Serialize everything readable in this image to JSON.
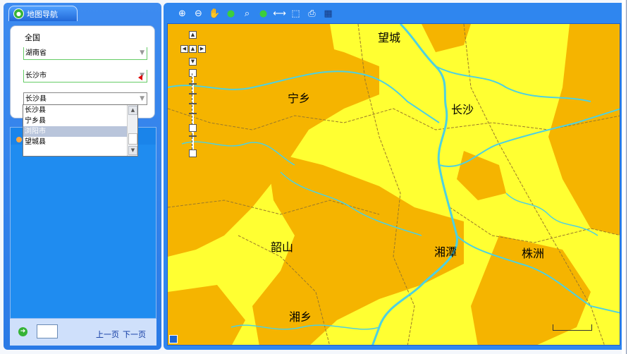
{
  "left_panel": {
    "tab_label": "地图导航",
    "region": {
      "label": "全国",
      "select1": "湖南省",
      "select2": "长沙市",
      "select3": "长沙县",
      "dropdown_options": [
        "长沙县",
        "宁乡县",
        "浏阳市",
        "望城县"
      ],
      "dropdown_selected": "浏阳市"
    },
    "pager": {
      "page_value": "",
      "prev": "上一页",
      "next": "下一页"
    }
  },
  "map": {
    "cities": [
      "望城",
      "宁乡",
      "长沙",
      "韶山",
      "湘潭",
      "株洲",
      "湘乡"
    ],
    "colors": {
      "land": "#ffff32",
      "upland": "#f5b400",
      "river": "#4ed1e0",
      "boundary": "#9a7a2a"
    }
  },
  "toolbar": {
    "tools": [
      "zoom-in-icon",
      "zoom-out-icon",
      "pan-icon",
      "full-extent-icon",
      "search-icon",
      "info-icon",
      "measure-icon",
      "select-icon",
      "print-icon",
      "layers-icon"
    ]
  }
}
